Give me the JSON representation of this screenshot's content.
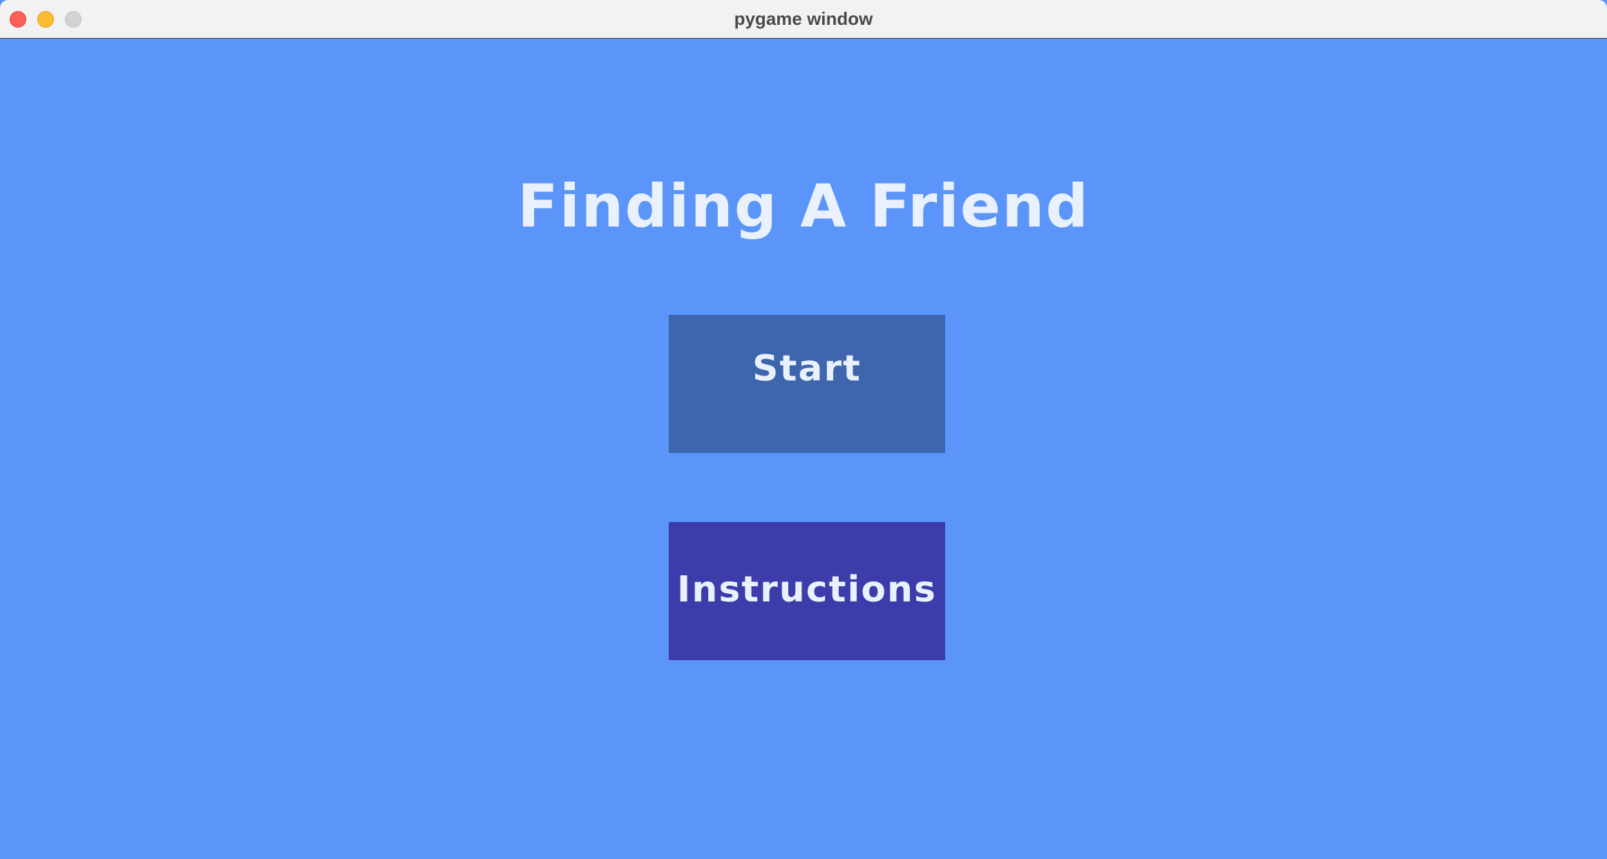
{
  "window": {
    "title": "pygame window"
  },
  "game": {
    "title": "Finding A Friend",
    "buttons": {
      "start": "Start",
      "instructions": "Instructions"
    }
  },
  "colors": {
    "background": "#5b95f9",
    "start_button": "#3d66ae",
    "instructions_button": "#3c3caa",
    "text": "#eaf1fe"
  }
}
